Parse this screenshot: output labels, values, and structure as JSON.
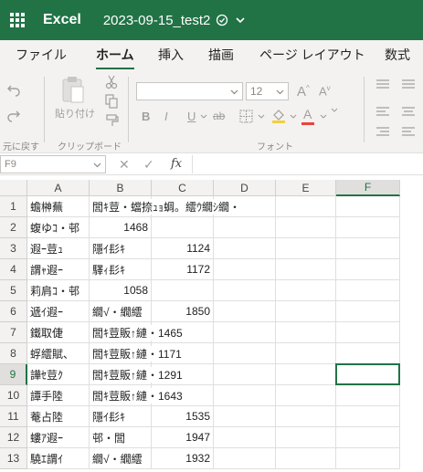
{
  "titlebar": {
    "app_name": "Excel",
    "doc_title": "2023-09-15_test2",
    "icons": [
      "app-launcher-icon",
      "autosave-icon",
      "chevron-down-icon"
    ]
  },
  "ribbon_tabs": [
    "ファイル",
    "ホーム",
    "挿入",
    "描画",
    "ページ レイアウト",
    "数式"
  ],
  "active_tab": "ホーム",
  "ribbon": {
    "undo_group_label": "元に戻す",
    "paste_label": "貼り付け",
    "clipboard_label": "クリップボード",
    "font_size": "12",
    "font_group_label": "フォント",
    "bold": "B",
    "italic": "I",
    "underline": "U",
    "strike": "ab",
    "font_color_letter": "A"
  },
  "formula_bar": {
    "name_box": "F9",
    "cancel": "✕",
    "enter": "✓",
    "fx": "fx",
    "value": ""
  },
  "grid": {
    "columns": [
      "A",
      "B",
      "C",
      "D",
      "E",
      "F"
    ],
    "selected_column": "F",
    "selected_row": 9,
    "rows": [
      {
        "n": "1",
        "a": "蟾榊蕪",
        "b": "閭ｷ荳・蟷捺ｭｮ蜩。繧ｳ繝ｼ繝・",
        "c": ""
      },
      {
        "n": "2",
        "a": "蝮ゆｺ・邨",
        "b": "1468",
        "c": ""
      },
      {
        "n": "3",
        "a": "遐ｰ荳ｭ",
        "b": "隱ｲ髟ｷ",
        "c": "1124"
      },
      {
        "n": "4",
        "a": "謂ｬ遐ｰ",
        "b": "驛ｨ髟ｷ",
        "c": "1172"
      },
      {
        "n": "5",
        "a": "莉肩ｺ・邨",
        "b": "1058",
        "c": ""
      },
      {
        "n": "6",
        "a": "遞ｲ遐ｰ",
        "b": "繝√・繝繧",
        "c": "1850"
      },
      {
        "n": "7",
        "a": "鐵取倢",
        "b": "閭ｷ荳販↑縺・1465",
        "c": ""
      },
      {
        "n": "8",
        "a": "蜉繧賦、",
        "b": "閭ｷ荳販↑縺・1171",
        "c": ""
      },
      {
        "n": "9",
        "a": "譁ｾ荳ｸ",
        "b": "閭ｷ荳販↑縺・1291",
        "c": ""
      },
      {
        "n": "10",
        "a": "譚手陸",
        "b": "閭ｷ荳販↑縺・1643",
        "c": ""
      },
      {
        "n": "11",
        "a": "菴占陸",
        "b": "隱ｲ髟ｷ",
        "c": "1535"
      },
      {
        "n": "12",
        "a": "螻ｱ遐ｰ",
        "b": "邨・閭",
        "c": "1947"
      },
      {
        "n": "13",
        "a": "驍ｴ謂ｲ",
        "b": "繝√・繝繧",
        "c": "1932"
      }
    ]
  },
  "colors": {
    "brand": "#217346",
    "ribbon_bg": "#f3f2f1",
    "gridline": "#e1dfdd"
  }
}
